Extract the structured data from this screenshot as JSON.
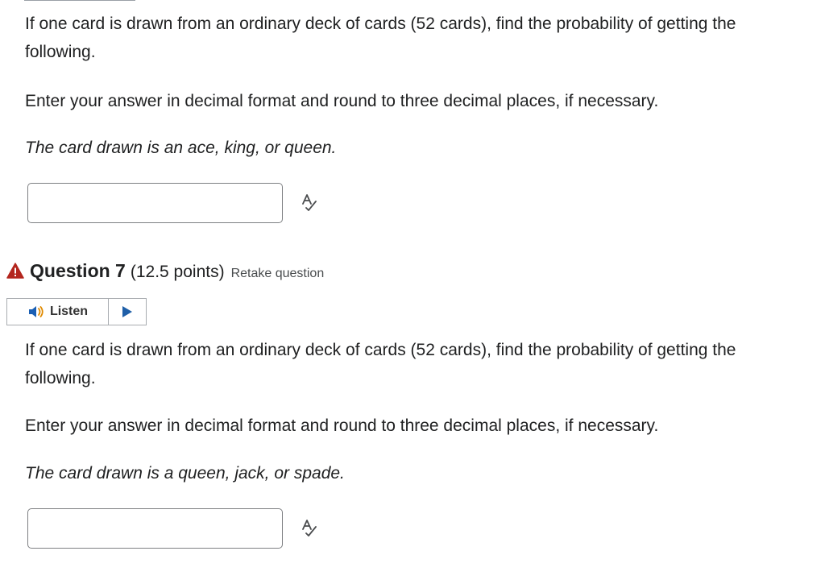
{
  "previous_question": {
    "prompt": "If one card is drawn from an ordinary deck of cards (52 cards), find the probability of getting the following.",
    "instructions": "Enter your answer in decimal format and round to three decimal places, if necessary.",
    "condition": "The card drawn is an ace, king, or queen.",
    "answer_value": "",
    "spellcheck_icon": "spellcheck-icon"
  },
  "question": {
    "warning_icon": "warning-triangle-icon",
    "title": "Question 7",
    "points": "(12.5 points)",
    "retake_label": "Retake question",
    "listen_label": "Listen",
    "speaker_icon": "speaker-icon",
    "play_icon": "play-icon",
    "prompt": "If one card is drawn from an ordinary deck of cards (52 cards), find the probability of getting the following.",
    "instructions": "Enter your answer in decimal format and round to three decimal places, if necessary.",
    "condition": "The card drawn is a queen, jack, or spade.",
    "answer_value": "",
    "spellcheck_icon": "spellcheck-icon"
  },
  "colors": {
    "warning": "#b3261e",
    "text": "#202122",
    "input_border": "#7d7f82",
    "speaker_blue": "#1a5fb4",
    "speaker_orange": "#e08a00",
    "play": "#1f5fa8"
  }
}
